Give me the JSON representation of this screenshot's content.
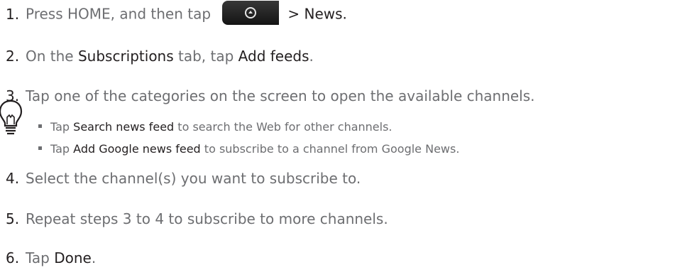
{
  "steps": [
    {
      "num": "1.",
      "parts": {
        "a": "Press HOME, and then tap ",
        "b": "> News."
      }
    },
    {
      "num": "2.",
      "parts": {
        "a": "On the ",
        "b": "Subscriptions",
        "c": " tab, tap ",
        "d": "Add feeds",
        "e": "."
      }
    },
    {
      "num": "3.",
      "parts": {
        "a": "Tap one of the categories on the screen to open the available channels."
      }
    },
    {
      "num": "4.",
      "parts": {
        "a": "Select the channel(s) you want to subscribe to."
      }
    },
    {
      "num": "5.",
      "parts": {
        "a": "Repeat steps 3 to 4 to subscribe to more channels."
      }
    },
    {
      "num": "6.",
      "parts": {
        "a": "Tap ",
        "b": "Done",
        "c": "."
      }
    }
  ],
  "tips": [
    {
      "a": "Tap ",
      "b": "Search news feed",
      "c": " to search the Web for other channels."
    },
    {
      "a": "Tap ",
      "b": "Add Google news feed",
      "c": " to subscribe to a channel from Google News."
    }
  ],
  "icons": {
    "tip": "lightbulb-icon",
    "all_apps": "all-apps-button-icon"
  }
}
